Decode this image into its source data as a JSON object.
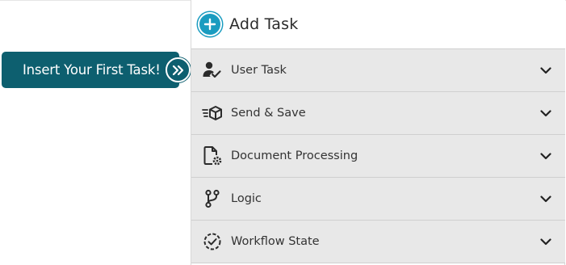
{
  "callout": {
    "label": "Insert Your First Task!",
    "arrow_icon": "double-chevron-right-icon"
  },
  "panel": {
    "title": "Add Task",
    "add_icon": "plus-circle-icon",
    "categories": [
      {
        "label": "User Task",
        "icon": "user-check-icon"
      },
      {
        "label": "Send & Save",
        "icon": "send-box-icon"
      },
      {
        "label": "Document Processing",
        "icon": "document-gear-icon"
      },
      {
        "label": "Logic",
        "icon": "branch-icon"
      },
      {
        "label": "Workflow State",
        "icon": "dashed-circle-check-icon"
      }
    ]
  },
  "colors": {
    "callout_bg": "#0d5f6f",
    "accent_blue": "#1a9cc0",
    "row_bg": "#e8e8e8",
    "text": "#333333"
  }
}
